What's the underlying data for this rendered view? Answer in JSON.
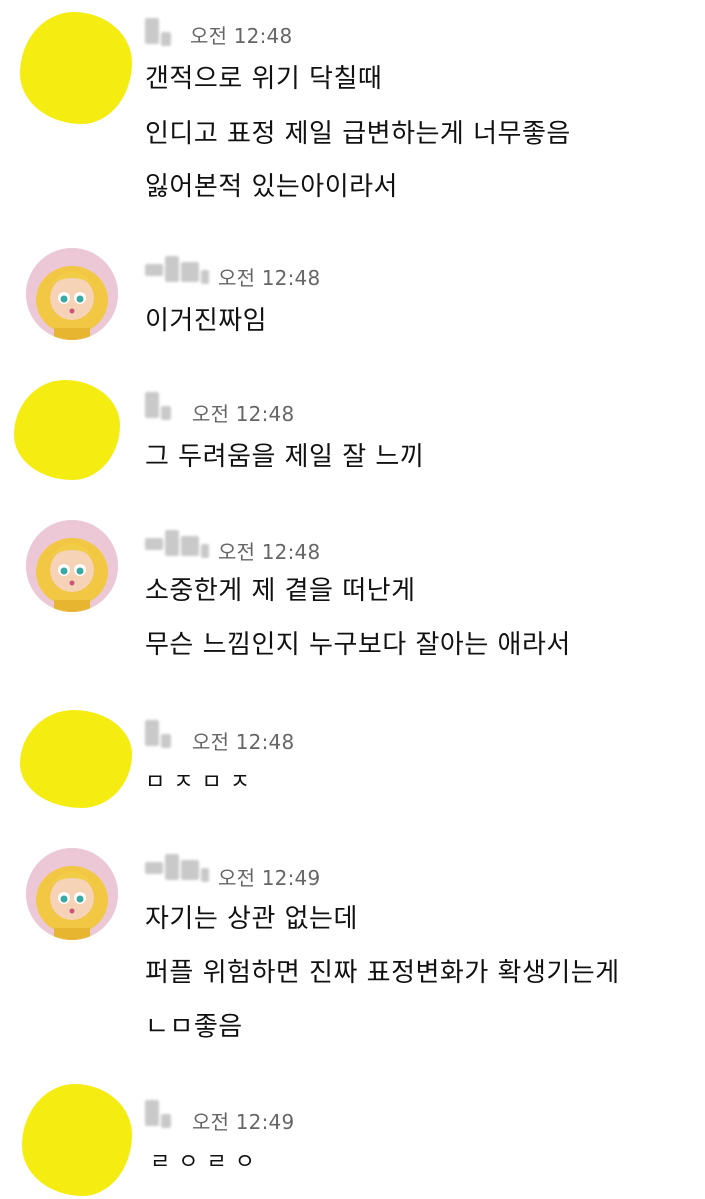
{
  "chat": {
    "messages": [
      {
        "avatar": "yellow-blob",
        "time": "오전 12:48",
        "lines": [
          "갠적으로 위기 닥칠때",
          "인디고 표정 제일 급변하는게 너무좋음",
          "잃어본적 있는아이라서"
        ]
      },
      {
        "avatar": "cartoon-girl",
        "time": "오전 12:48",
        "lines": [
          "이거진짜임"
        ]
      },
      {
        "avatar": "yellow-blob",
        "time": "오전 12:48",
        "lines": [
          "그 두려움을 제일 잘 느끼"
        ]
      },
      {
        "avatar": "cartoon-girl",
        "time": "오전 12:48",
        "lines": [
          "소중한게 제 곁을 떠난게",
          "무슨 느낌인지 누구보다 잘아는 애라서"
        ]
      },
      {
        "avatar": "yellow-blob",
        "time": "오전 12:48",
        "lines": [
          "ㅁㅈㅁㅈ"
        ]
      },
      {
        "avatar": "cartoon-girl",
        "time": "오전 12:49",
        "lines": [
          "자기는 상관 없는데",
          "퍼플 위험하면 진짜 표정변화가 확생기는게",
          "ㄴㅁ좋음"
        ]
      },
      {
        "avatar": "yellow-blob",
        "time": "오전 12:49",
        "lines": [
          "ㄹㅇㄹㅇ"
        ]
      }
    ]
  },
  "colors": {
    "blob": "#f5ec12",
    "time": "#666666",
    "text": "#111111",
    "background": "#ffffff"
  }
}
